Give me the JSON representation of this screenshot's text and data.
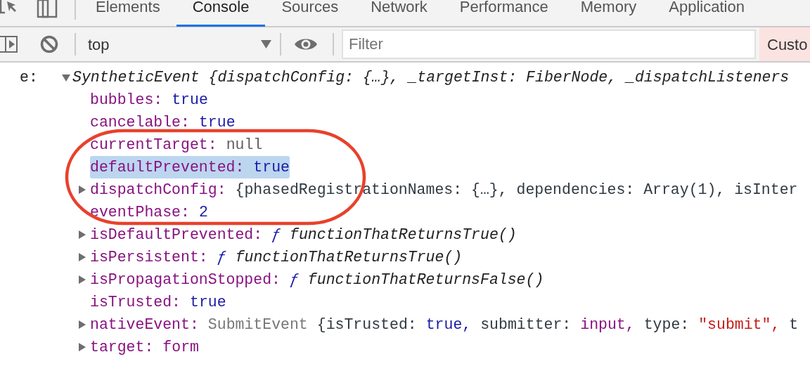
{
  "tabs": [
    {
      "label": "Elements",
      "selected": false
    },
    {
      "label": "Console",
      "selected": true
    },
    {
      "label": "Sources",
      "selected": false
    },
    {
      "label": "Network",
      "selected": false
    },
    {
      "label": "Performance",
      "selected": false
    },
    {
      "label": "Memory",
      "selected": false
    },
    {
      "label": "Application",
      "selected": false
    }
  ],
  "toolbar": {
    "context": "top",
    "filter": {
      "placeholder": "Filter"
    },
    "levels_button": "Custo"
  },
  "console": {
    "label": "e:",
    "expanded": true,
    "summary": [
      {
        "kind": "italic",
        "text": "SyntheticEvent {dispatchConfig: {…}, _targetInst: FiberNode, _dispatchListeners"
      }
    ],
    "properties": [
      {
        "key": "bubbles:",
        "expandable": false,
        "highlighted": false,
        "value": [
          {
            "kind": "keyword",
            "text": "true"
          }
        ]
      },
      {
        "key": "cancelable:",
        "expandable": false,
        "highlighted": false,
        "value": [
          {
            "kind": "keyword",
            "text": "true"
          }
        ]
      },
      {
        "key": "currentTarget:",
        "expandable": false,
        "highlighted": false,
        "value": [
          {
            "kind": "null",
            "text": "null"
          }
        ]
      },
      {
        "key": "defaultPrevented:",
        "expandable": false,
        "highlighted": true,
        "value": [
          {
            "kind": "keyword",
            "text": "true"
          }
        ]
      },
      {
        "key": "dispatchConfig:",
        "expandable": true,
        "highlighted": false,
        "value": [
          {
            "kind": "plain",
            "text": "{phasedRegistrationNames: {…}, dependencies: Array(1), isInter"
          }
        ]
      },
      {
        "key": "eventPhase:",
        "expandable": false,
        "highlighted": false,
        "value": [
          {
            "kind": "keyword",
            "text": "2"
          }
        ]
      },
      {
        "key": "isDefaultPrevented:",
        "expandable": true,
        "highlighted": false,
        "value": [
          {
            "kind": "fn",
            "text": "ƒ"
          },
          {
            "kind": "italic",
            "text": "functionThatReturnsTrue()"
          }
        ]
      },
      {
        "key": "isPersistent:",
        "expandable": true,
        "highlighted": false,
        "value": [
          {
            "kind": "fn",
            "text": "ƒ"
          },
          {
            "kind": "italic",
            "text": "functionThatReturnsTrue()"
          }
        ]
      },
      {
        "key": "isPropagationStopped:",
        "expandable": true,
        "highlighted": false,
        "value": [
          {
            "kind": "fn",
            "text": "ƒ"
          },
          {
            "kind": "italic",
            "text": "functionThatReturnsFalse()"
          }
        ]
      },
      {
        "key": "isTrusted:",
        "expandable": false,
        "highlighted": false,
        "value": [
          {
            "kind": "keyword",
            "text": "true"
          }
        ]
      },
      {
        "key": "nativeEvent:",
        "expandable": true,
        "highlighted": false,
        "value": [
          {
            "kind": "type",
            "text": "SubmitEvent"
          },
          {
            "kind": "plain",
            "text": "{isTrusted:"
          },
          {
            "kind": "keyword",
            "text": "true,"
          },
          {
            "kind": "plain",
            "text": "submitter:"
          },
          {
            "kind": "node",
            "text": "input,"
          },
          {
            "kind": "plain",
            "text": "type:"
          },
          {
            "kind": "string",
            "text": "\"submit\","
          },
          {
            "kind": "plain",
            "text": "t"
          }
        ]
      },
      {
        "key": "target:",
        "expandable": true,
        "highlighted": false,
        "value": [
          {
            "kind": "node",
            "text": "form"
          }
        ]
      }
    ]
  },
  "annotations": [
    {
      "kind": "ellipse"
    }
  ]
}
